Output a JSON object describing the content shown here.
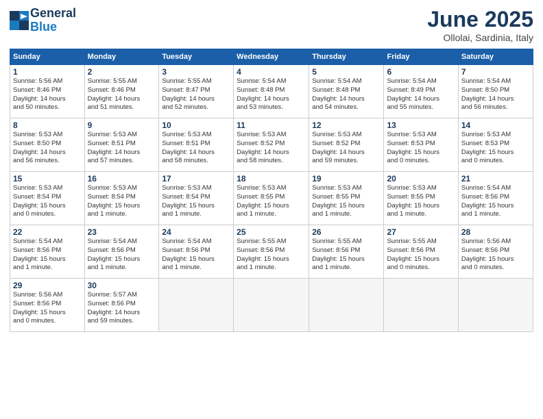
{
  "header": {
    "logo_line1": "General",
    "logo_line2": "Blue",
    "month": "June 2025",
    "location": "Ollolai, Sardinia, Italy"
  },
  "columns": [
    "Sunday",
    "Monday",
    "Tuesday",
    "Wednesday",
    "Thursday",
    "Friday",
    "Saturday"
  ],
  "weeks": [
    [
      {
        "day": "1",
        "info": "Sunrise: 5:56 AM\nSunset: 8:46 PM\nDaylight: 14 hours\nand 50 minutes."
      },
      {
        "day": "2",
        "info": "Sunrise: 5:55 AM\nSunset: 8:46 PM\nDaylight: 14 hours\nand 51 minutes."
      },
      {
        "day": "3",
        "info": "Sunrise: 5:55 AM\nSunset: 8:47 PM\nDaylight: 14 hours\nand 52 minutes."
      },
      {
        "day": "4",
        "info": "Sunrise: 5:54 AM\nSunset: 8:48 PM\nDaylight: 14 hours\nand 53 minutes."
      },
      {
        "day": "5",
        "info": "Sunrise: 5:54 AM\nSunset: 8:48 PM\nDaylight: 14 hours\nand 54 minutes."
      },
      {
        "day": "6",
        "info": "Sunrise: 5:54 AM\nSunset: 8:49 PM\nDaylight: 14 hours\nand 55 minutes."
      },
      {
        "day": "7",
        "info": "Sunrise: 5:54 AM\nSunset: 8:50 PM\nDaylight: 14 hours\nand 56 minutes."
      }
    ],
    [
      {
        "day": "8",
        "info": "Sunrise: 5:53 AM\nSunset: 8:50 PM\nDaylight: 14 hours\nand 56 minutes."
      },
      {
        "day": "9",
        "info": "Sunrise: 5:53 AM\nSunset: 8:51 PM\nDaylight: 14 hours\nand 57 minutes."
      },
      {
        "day": "10",
        "info": "Sunrise: 5:53 AM\nSunset: 8:51 PM\nDaylight: 14 hours\nand 58 minutes."
      },
      {
        "day": "11",
        "info": "Sunrise: 5:53 AM\nSunset: 8:52 PM\nDaylight: 14 hours\nand 58 minutes."
      },
      {
        "day": "12",
        "info": "Sunrise: 5:53 AM\nSunset: 8:52 PM\nDaylight: 14 hours\nand 59 minutes."
      },
      {
        "day": "13",
        "info": "Sunrise: 5:53 AM\nSunset: 8:53 PM\nDaylight: 15 hours\nand 0 minutes."
      },
      {
        "day": "14",
        "info": "Sunrise: 5:53 AM\nSunset: 8:53 PM\nDaylight: 15 hours\nand 0 minutes."
      }
    ],
    [
      {
        "day": "15",
        "info": "Sunrise: 5:53 AM\nSunset: 8:54 PM\nDaylight: 15 hours\nand 0 minutes."
      },
      {
        "day": "16",
        "info": "Sunrise: 5:53 AM\nSunset: 8:54 PM\nDaylight: 15 hours\nand 1 minute."
      },
      {
        "day": "17",
        "info": "Sunrise: 5:53 AM\nSunset: 8:54 PM\nDaylight: 15 hours\nand 1 minute."
      },
      {
        "day": "18",
        "info": "Sunrise: 5:53 AM\nSunset: 8:55 PM\nDaylight: 15 hours\nand 1 minute."
      },
      {
        "day": "19",
        "info": "Sunrise: 5:53 AM\nSunset: 8:55 PM\nDaylight: 15 hours\nand 1 minute."
      },
      {
        "day": "20",
        "info": "Sunrise: 5:53 AM\nSunset: 8:55 PM\nDaylight: 15 hours\nand 1 minute."
      },
      {
        "day": "21",
        "info": "Sunrise: 5:54 AM\nSunset: 8:56 PM\nDaylight: 15 hours\nand 1 minute."
      }
    ],
    [
      {
        "day": "22",
        "info": "Sunrise: 5:54 AM\nSunset: 8:56 PM\nDaylight: 15 hours\nand 1 minute."
      },
      {
        "day": "23",
        "info": "Sunrise: 5:54 AM\nSunset: 8:56 PM\nDaylight: 15 hours\nand 1 minute."
      },
      {
        "day": "24",
        "info": "Sunrise: 5:54 AM\nSunset: 8:56 PM\nDaylight: 15 hours\nand 1 minute."
      },
      {
        "day": "25",
        "info": "Sunrise: 5:55 AM\nSunset: 8:56 PM\nDaylight: 15 hours\nand 1 minute."
      },
      {
        "day": "26",
        "info": "Sunrise: 5:55 AM\nSunset: 8:56 PM\nDaylight: 15 hours\nand 1 minute."
      },
      {
        "day": "27",
        "info": "Sunrise: 5:55 AM\nSunset: 8:56 PM\nDaylight: 15 hours\nand 0 minutes."
      },
      {
        "day": "28",
        "info": "Sunrise: 5:56 AM\nSunset: 8:56 PM\nDaylight: 15 hours\nand 0 minutes."
      }
    ],
    [
      {
        "day": "29",
        "info": "Sunrise: 5:56 AM\nSunset: 8:56 PM\nDaylight: 15 hours\nand 0 minutes."
      },
      {
        "day": "30",
        "info": "Sunrise: 5:57 AM\nSunset: 8:56 PM\nDaylight: 14 hours\nand 59 minutes."
      },
      null,
      null,
      null,
      null,
      null
    ]
  ]
}
